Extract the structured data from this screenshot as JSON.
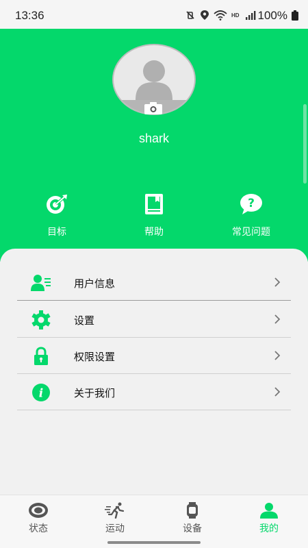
{
  "status_bar": {
    "time": "13:36",
    "battery": "100%"
  },
  "profile": {
    "username": "shark"
  },
  "quick_actions": [
    {
      "label": "目标",
      "icon": "target-icon"
    },
    {
      "label": "帮助",
      "icon": "book-icon"
    },
    {
      "label": "常见问题",
      "icon": "question-bubble-icon"
    }
  ],
  "menu": [
    {
      "label": "用户信息",
      "icon": "user-info-icon"
    },
    {
      "label": "设置",
      "icon": "gear-icon"
    },
    {
      "label": "权限设置",
      "icon": "lock-icon"
    },
    {
      "label": "关于我们",
      "icon": "info-icon"
    }
  ],
  "tabs": [
    {
      "label": "状态",
      "icon": "eye-icon",
      "active": false
    },
    {
      "label": "运动",
      "icon": "running-icon",
      "active": false
    },
    {
      "label": "设备",
      "icon": "watch-icon",
      "active": false
    },
    {
      "label": "我的",
      "icon": "person-icon",
      "active": true
    }
  ],
  "colors": {
    "accent": "#04d86b",
    "background": "#f1f1f1",
    "inactive_tab": "#555555"
  }
}
